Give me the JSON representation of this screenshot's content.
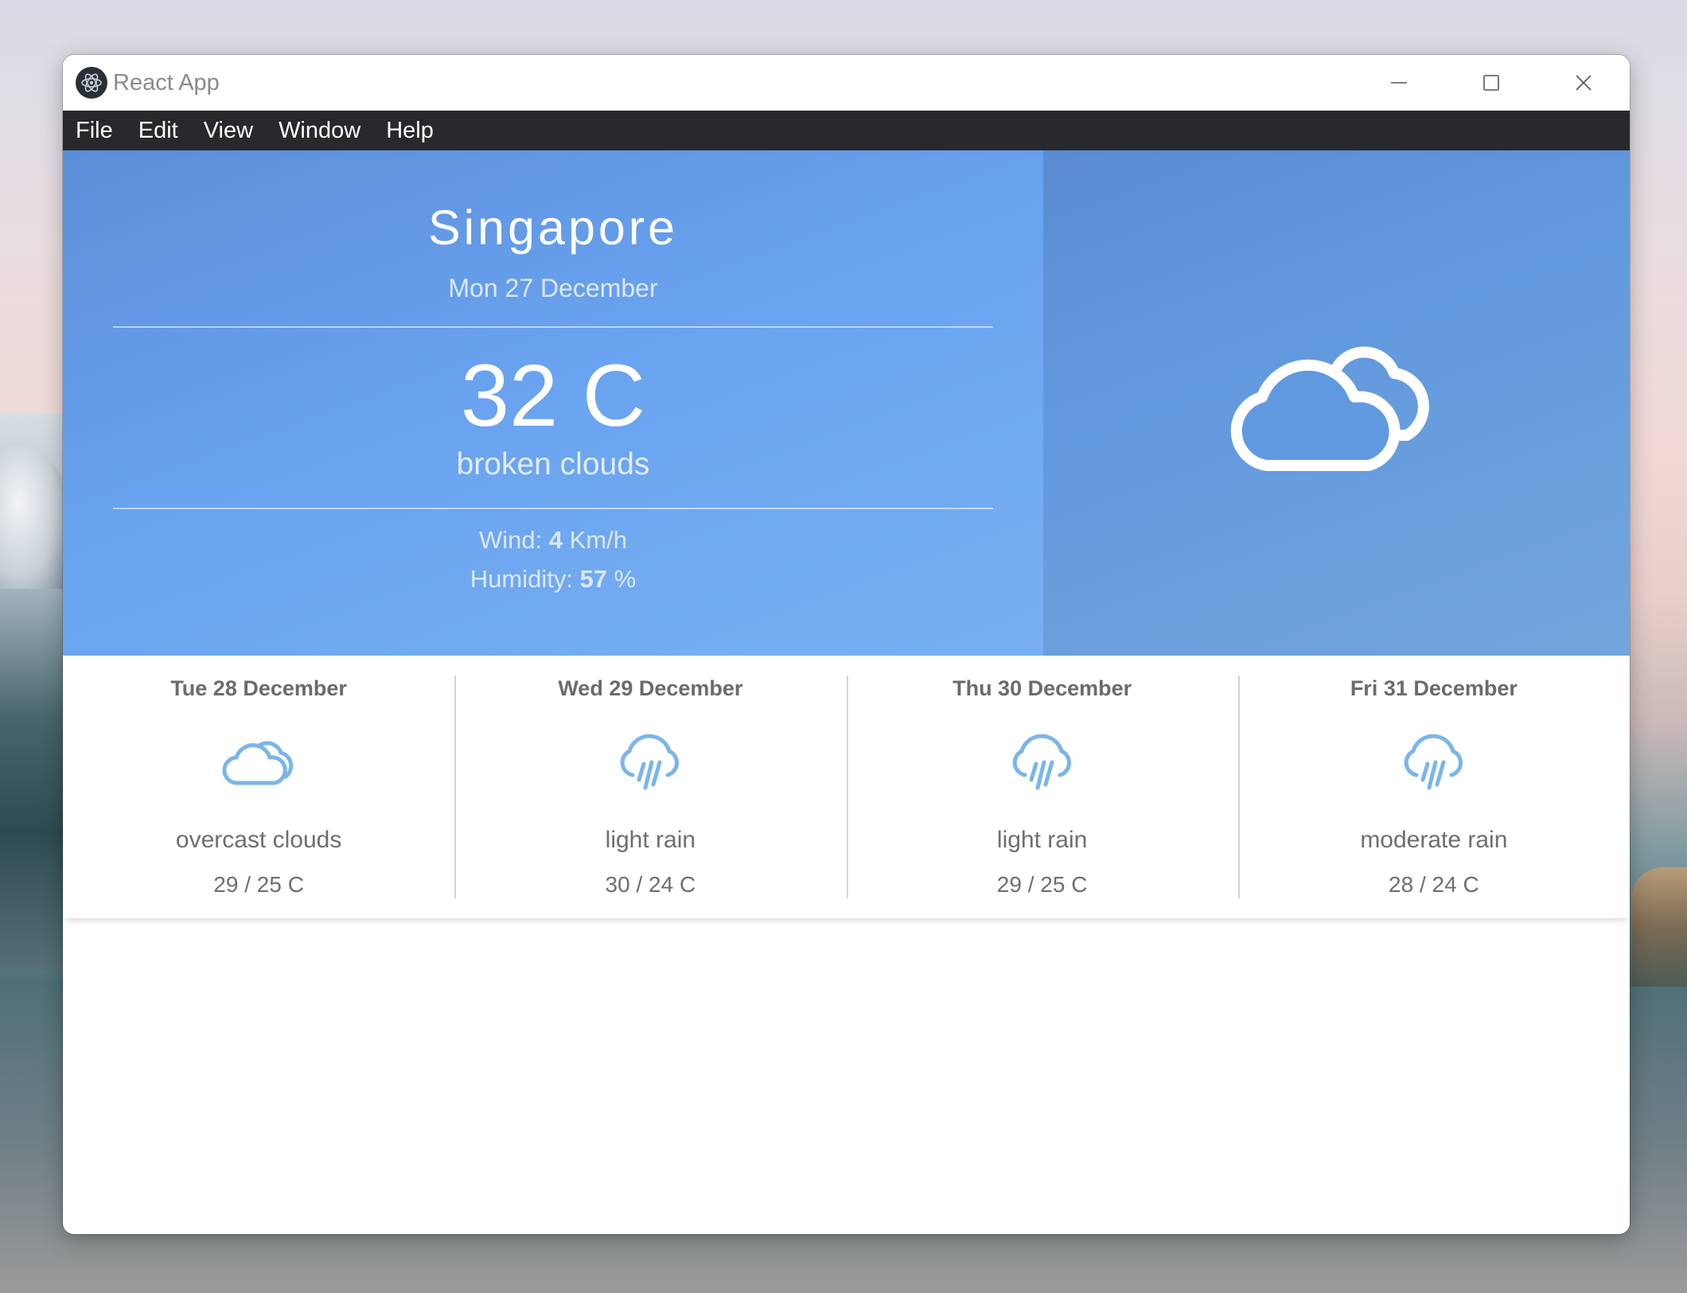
{
  "window": {
    "title": "React App",
    "icon": "electron-atom-icon"
  },
  "menu": [
    "File",
    "Edit",
    "View",
    "Window",
    "Help"
  ],
  "current": {
    "city": "Singapore",
    "date": "Mon 27 December",
    "temperature": "32 C",
    "description": "broken clouds",
    "wind_label": "Wind: ",
    "wind_value": "4",
    "wind_unit": " Km/h",
    "humidity_label": "Humidity: ",
    "humidity_value": "57",
    "humidity_unit": " %",
    "icon": "partly-cloudy-icon"
  },
  "forecast": [
    {
      "date": "Tue 28 December",
      "description": "overcast clouds",
      "range": "29 / 25 C",
      "icon": "cloud-icon"
    },
    {
      "date": "Wed 29 December",
      "description": "light rain",
      "range": "30 / 24 C",
      "icon": "rain-icon"
    },
    {
      "date": "Thu 30 December",
      "description": "light rain",
      "range": "29 / 25 C",
      "icon": "rain-icon"
    },
    {
      "date": "Fri 31 December",
      "description": "moderate rain",
      "range": "28 / 24 C",
      "icon": "rain-icon"
    }
  ],
  "colors": {
    "hero_blue": "#69a2ef",
    "icon_blue": "#78b6e8",
    "menubar": "#27292d"
  }
}
